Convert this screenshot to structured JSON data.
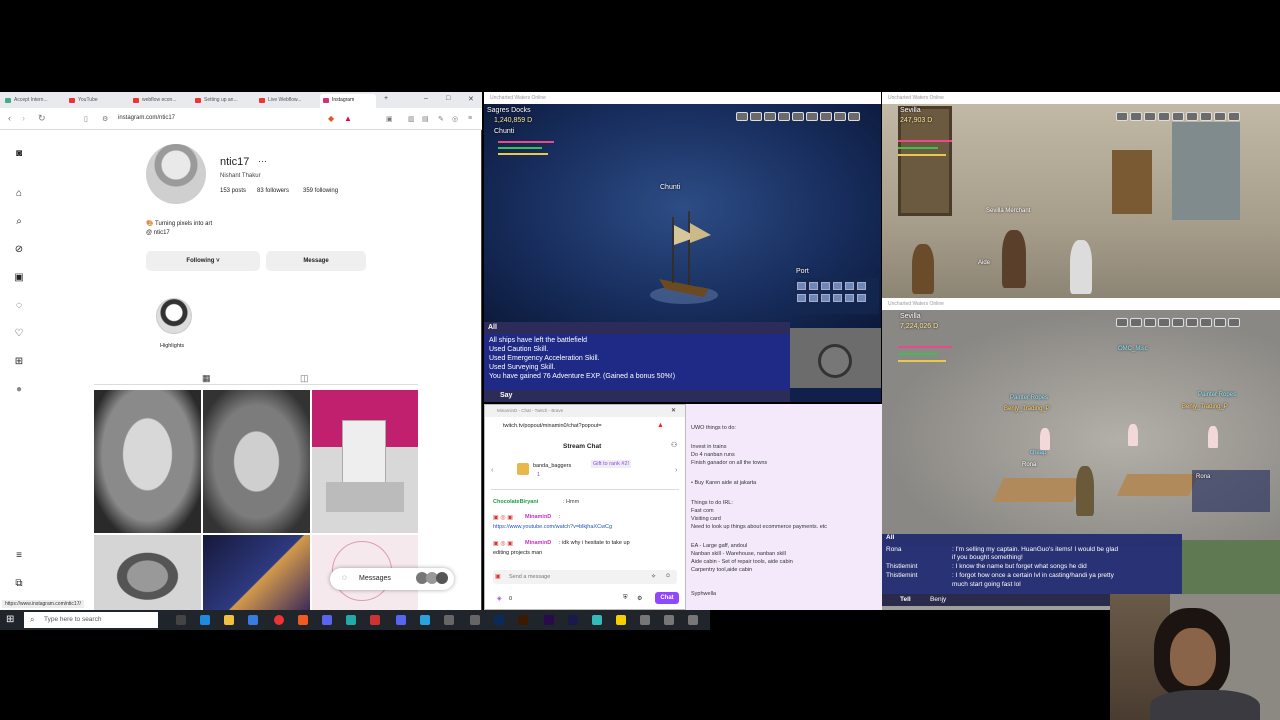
{
  "browser": {
    "tabs": [
      "Accept Intern...",
      "YouTube",
      "webflow econ...",
      "Setting up an...",
      "Live Webflow...",
      "Instagram"
    ],
    "url": "instagram.com/ntic17",
    "status_url": "https://www.instagram.com/ntic17/"
  },
  "instagram": {
    "username": "ntic17",
    "full_name": "Nishant Thakur",
    "stats": {
      "posts": "153 posts",
      "followers": "83 followers",
      "following": "359 following"
    },
    "bio_line1": "🎨 Turning pixels into art",
    "bio_line2": "@ ntic17",
    "following_button": "Following ˅",
    "message_button": "Message",
    "highlight_label": "Highlights",
    "messages_label": "Messages"
  },
  "game1": {
    "location": "Sagres Docks",
    "ducats": "1,240,859 D",
    "player": "Chunti",
    "ship_label": "Chunti",
    "port_label": "Port",
    "chat_tab": "All",
    "say_label": "Say",
    "chat_lines": [
      "All ships have left the battlefield",
      "Used Caution Skill.",
      "Used Emergency Acceleration Skill.",
      "Used Surveying Skill.",
      "You have gained 76 Adventure EXP. (Gained a bonus 50%!)"
    ]
  },
  "twitch": {
    "url": "twitch.tv/popout/minamin0/chat?popout=",
    "title": "Stream Chat",
    "gift_user": "banda_baggers",
    "gift_text": "Gift to rank #2!",
    "gift_count": "1",
    "messages": [
      {
        "user": "ChocolateBiryani",
        "text": ": Hmm"
      },
      {
        "user": "MinaminD",
        "text": ":"
      },
      {
        "user": "",
        "text": "https://www.youtube.com/watch?v=blkjhaXCwCg"
      },
      {
        "user": "MinaminD",
        "text": ": idk why i hesitate to take up"
      },
      {
        "user": "",
        "text": "editing projects man"
      }
    ],
    "input_placeholder": "Send a message",
    "chat_button": "Chat",
    "points": "0"
  },
  "notes": {
    "lines": [
      "UWO things to do:",
      "",
      "Invest in trains",
      "Do 4 nanban runs",
      "Finish ganador on all the towns",
      "",
      "• Buy Karen aide at jakarta",
      "",
      "Things to do IRL:",
      "Fast com",
      "Visiting card",
      "Need to look up things about ecommerce payments. etc",
      "",
      "EA - Large gaff, andoul",
      "Nanban skill - Warehouse, nanban skill",
      "Aide cabin - Set of repair tools, aide cabin",
      "Carpentry tool,aide cabin",
      "",
      "",
      "Syphwella"
    ]
  },
  "game2": {
    "location": "Sevilla",
    "ducats": "247,903 D",
    "names": [
      "Aide",
      "Sevilla Merchant"
    ]
  },
  "game3": {
    "location": "Sevilla",
    "ducats": "7,224,026 D",
    "player_badge": "Rona",
    "labels": [
      "Painter Ropes",
      "Benjy_Trading_P",
      "Painter Ropes",
      "Benjy_Trading_P",
      "cheap",
      "Rona",
      "OMC_Misc"
    ],
    "chat_tab": "All",
    "chat_lines": [
      {
        "name": "Rona",
        "text": ": I'm selling my captain. HuanGuo's items! I would be glad"
      },
      {
        "name": "",
        "text": "  if you bought something!"
      },
      {
        "name": "Thistlemint",
        "text": ": I know the name but forget what songs he did"
      },
      {
        "name": "Thistlemint",
        "text": ": I forgot how once a certain lvl in casting/handi ya pretty"
      },
      {
        "name": "",
        "text": "  much start going fast lol"
      }
    ],
    "tell_label": "Tell",
    "tell_target": "Benjy"
  },
  "taskbar": {
    "search_placeholder": "Type here to search"
  }
}
